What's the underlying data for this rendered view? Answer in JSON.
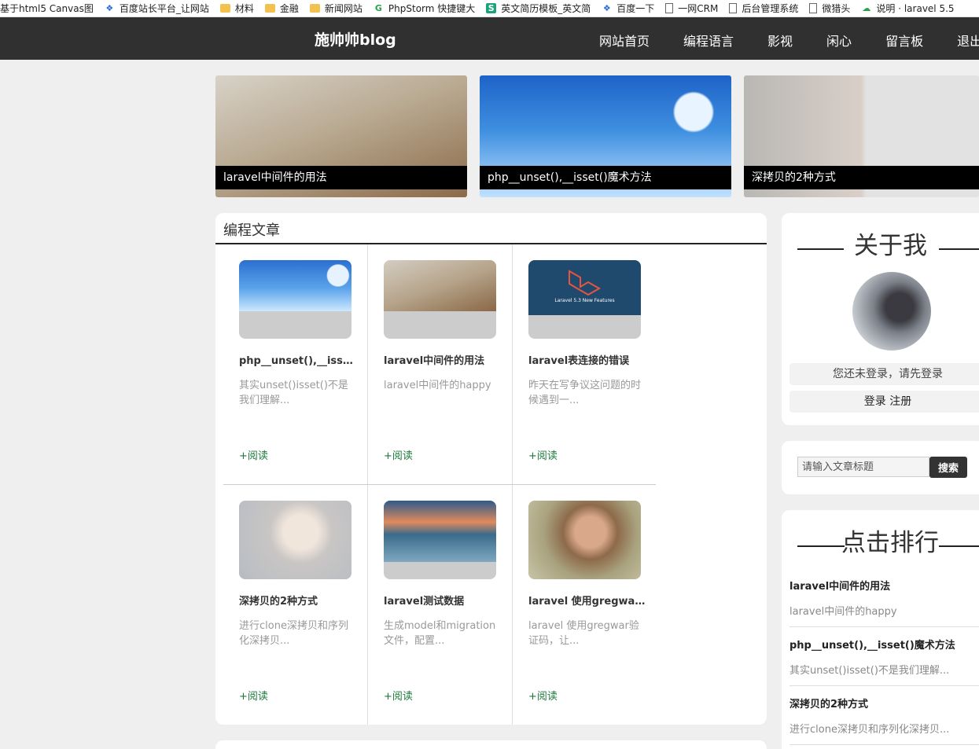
{
  "bookmarks": [
    {
      "icon": "none",
      "label": "基于html5 Canvas图"
    },
    {
      "icon": "paw-icon",
      "label": "百度站长平台_让网站"
    },
    {
      "icon": "folder-icon",
      "label": "材料"
    },
    {
      "icon": "folder-icon",
      "label": "金融"
    },
    {
      "icon": "folder-icon",
      "label": "新闻网站"
    },
    {
      "icon": "g-icon",
      "label": "PhpStorm 快捷键大"
    },
    {
      "icon": "s-icon",
      "label": "英文简历模板_英文简"
    },
    {
      "icon": "paw-icon",
      "label": "百度一下"
    },
    {
      "icon": "page-icon",
      "label": "一网CRM"
    },
    {
      "icon": "page-icon",
      "label": "后台管理系统"
    },
    {
      "icon": "page-icon",
      "label": "微猎头"
    },
    {
      "icon": "cloud-icon",
      "label": "说明 · laravel 5.5"
    }
  ],
  "nav": {
    "site_title": "施帅帅blog",
    "links": [
      "网站首页",
      "编程语言",
      "影视",
      "闲心",
      "留言板",
      "退出"
    ]
  },
  "banners": [
    {
      "caption": "laravel中间件的用法"
    },
    {
      "caption": "php__unset(),__isset()魔术方法"
    },
    {
      "caption": "深拷贝的2种方式"
    }
  ],
  "main": {
    "section_title": "编程文章",
    "read_label": "+阅读",
    "cards": [
      {
        "title": "php__unset(),__isset()魔术方法",
        "desc": "其实unset()isset()不是我们理解..."
      },
      {
        "title": "laravel中间件的用法",
        "desc": "laravel中间件的happy"
      },
      {
        "title": "laravel表连接的错误",
        "desc": "昨天在写争议这问题的时候遇到一..."
      },
      {
        "title": "深拷贝的2种方式",
        "desc": "进行clone深拷贝和序列化深拷贝..."
      },
      {
        "title": "laravel测试数据",
        "desc": "生成model和migration文件，配置..."
      },
      {
        "title": "laravel 使用gregwar验证码",
        "desc": "laravel 使用gregwar验证码，让..."
      }
    ],
    "card3_image_text": "Laravel 5.3 New Features"
  },
  "sidebar": {
    "about_title": "关于我",
    "login_status": "您还未登录，请先登录",
    "login_label": "登录",
    "register_label": "注册",
    "search_placeholder": "请输入文章标题",
    "search_button": "搜索",
    "rank_title": "点击排行",
    "rank_items": [
      {
        "title": "laravel中间件的用法",
        "desc": "laravel中间件的happy"
      },
      {
        "title": "php__unset(),__isset()魔术方法",
        "desc": "其实unset()isset()不是我们理解..."
      },
      {
        "title": "深拷贝的2种方式",
        "desc": "进行clone深拷贝和序列化深拷贝..."
      }
    ]
  },
  "colors": {
    "nav_bg": "#303030",
    "read_link": "#1e7a3c",
    "search_button_bg": "#333333"
  }
}
